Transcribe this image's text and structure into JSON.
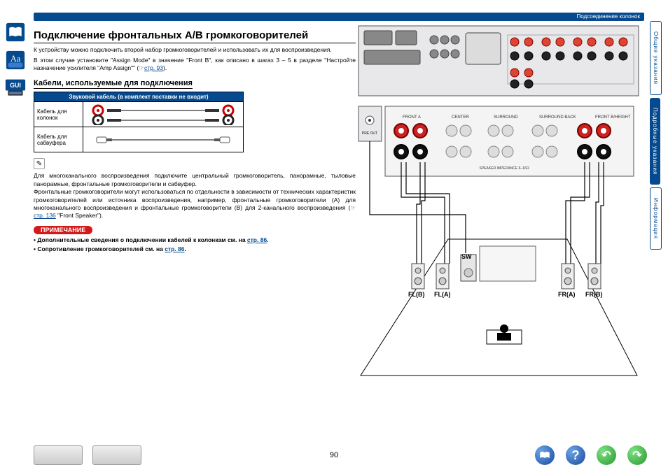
{
  "header": {
    "section": "Подсоединение колонок"
  },
  "title": "Подключение фронтальных A/B громкоговорителей",
  "intro1": "К устройству можно подключить второй набор громкоговорителей и использовать их для воспроизведения.",
  "intro2": "В этом случае установите \"Assign Mode\" в значение \"Front B\", как описано в шагах 3 – 5 в разделе \"Настройте назначение усилителя \"Amp Assign\"\" (",
  "intro2_link": "стр. 93",
  "intro2_end": ").",
  "cables": {
    "heading": "Кабели, используемые для подключения",
    "table_header": "Звуковой кабель (в комплект поставки не входит)",
    "row1": "Кабель для колонок",
    "row2": "Кабель для сабвуфера"
  },
  "note_block": "Для многоканального воспроизведения подключите центральный громкоговоритель, панорамные, тыловые панорамные, фронтальные громкоговорители и сабвуфер.\nФронтальные громкоговорители могут использоваться по отдельности в зависимости от технических характеристик громкоговорителей или источника воспроизведения, например, фронтальные громкоговорители (A) для многоканального воспроизведения и фронтальные громкоговорители (B) для 2-канального воспроизведения (",
  "note_block_link": "стр. 136",
  "note_block_end": " \"Front Speaker\").",
  "notice": {
    "label": "ПРИМЕЧАНИЕ",
    "b1_pre": "Дополнительные сведения о подключении кабелей к колонкам см. на ",
    "b1_link": "стр. 86",
    "b1_post": ".",
    "b2_pre": "Сопротивление громкоговорителей см. на ",
    "b2_link": "стр. 86",
    "b2_post": "."
  },
  "diagram": {
    "sw": "SW",
    "flb": "FL(B)",
    "fla": "FL(A)",
    "fra": "FR(A)",
    "frb": "FR(B)"
  },
  "tabs": {
    "t1": "Общие указания",
    "t2": "Подробные указания",
    "t3": "Информация"
  },
  "footer": {
    "page": "90",
    "help": "?",
    "back": "↶",
    "fwd": "↷"
  }
}
